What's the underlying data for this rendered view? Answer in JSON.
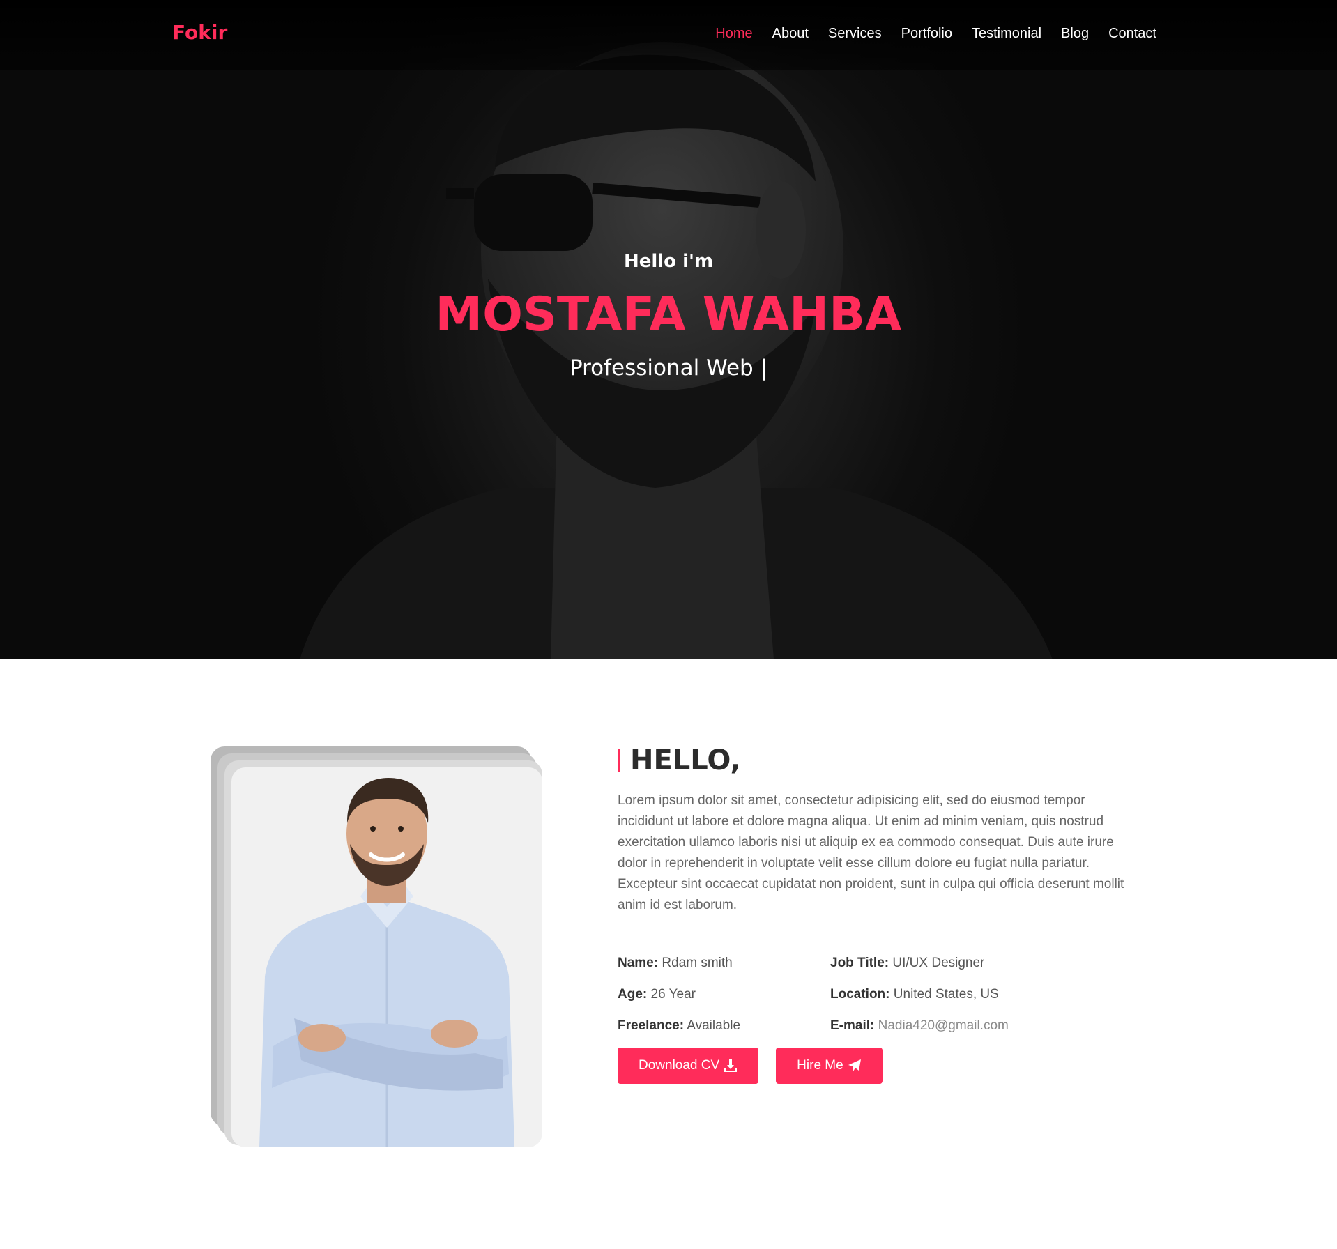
{
  "brand": "Fokir",
  "nav": [
    "Home",
    "About",
    "Services",
    "Portfolio",
    "Testimonial",
    "Blog",
    "Contact"
  ],
  "hero": {
    "greeting": "Hello i'm",
    "name": "MOSTAFA WAHBA",
    "subtitle": "Professional Web |"
  },
  "about": {
    "title": "HELLO,",
    "text": "Lorem ipsum dolor sit amet, consectetur adipisicing elit, sed do eiusmod tempor incididunt ut labore et dolore magna aliqua. Ut enim ad minim veniam, quis nostrud exercitation ullamco laboris nisi ut aliquip ex ea commodo consequat. Duis aute irure dolor in reprehenderit in voluptate velit esse cillum dolore eu fugiat nulla pariatur. Excepteur sint occaecat cupidatat non proident, sunt in culpa qui officia deserunt mollit anim id est laborum.",
    "info": {
      "name_label": "Name:",
      "name_value": "Rdam smith",
      "job_label": "Job Title:",
      "job_value": "UI/UX Designer",
      "age_label": "Age:",
      "age_value": "26 Year",
      "location_label": "Location:",
      "location_value": "United States, US",
      "freelance_label": "Freelance:",
      "freelance_value": "Available",
      "email_label": "E-mail:",
      "email_value": "Nadia420@gmail.com"
    },
    "buttons": {
      "download": "Download CV",
      "hire": "Hire Me"
    }
  },
  "colors": {
    "accent": "#ff2c5a",
    "hero_bg": "#0a0a0a",
    "text": "#666666"
  },
  "icons": {
    "download": "download-icon",
    "hire": "paper-plane-icon"
  }
}
